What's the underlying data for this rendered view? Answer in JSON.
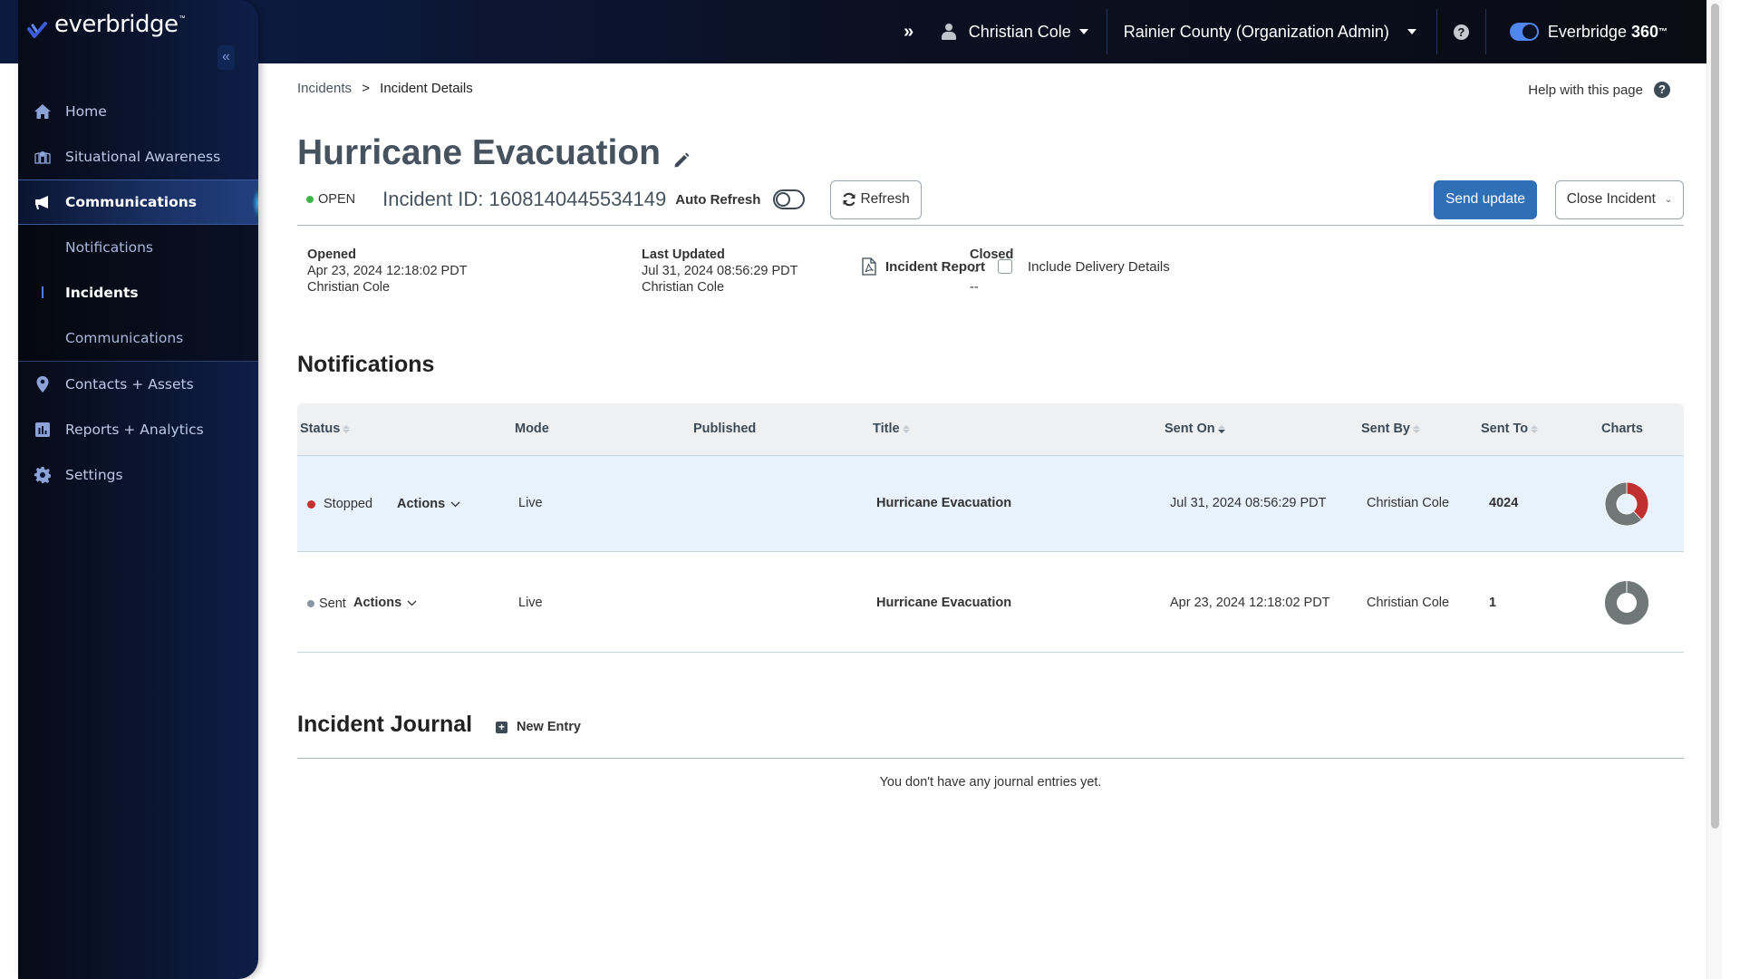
{
  "app": {
    "logo_text": "everbridge",
    "logo_tm": "™",
    "brand_color": "#4c7ef0"
  },
  "topbar": {
    "expand_icon": "double-chevron-right-icon",
    "user_name": "Christian Cole",
    "organization": "Rainier County (Organization Admin)",
    "help_symbol": "?",
    "product_name": "Everbridge",
    "product_suffix": "360",
    "product_tm": "™"
  },
  "sidebar": {
    "collapse_symbol": "«",
    "items": [
      {
        "label": "Home",
        "icon": "home-icon"
      },
      {
        "label": "Situational Awareness",
        "icon": "map-icon"
      },
      {
        "label": "Communications",
        "icon": "megaphone-icon",
        "active": true
      },
      {
        "label": "Contacts + Assets",
        "icon": "location-pin-icon"
      },
      {
        "label": "Reports + Analytics",
        "icon": "bar-chart-icon"
      },
      {
        "label": "Settings",
        "icon": "gear-icon"
      }
    ],
    "subitems": [
      {
        "label": "Notifications"
      },
      {
        "label": "Incidents",
        "current": true
      },
      {
        "label": "Communications"
      }
    ]
  },
  "breadcrumb": {
    "parent": "Incidents",
    "separator": ">",
    "current": "Incident Details"
  },
  "help": {
    "label": "Help with this page",
    "symbol": "?"
  },
  "incident": {
    "title": "Hurricane Evacuation",
    "status": "OPEN",
    "status_color": "#3cb64a",
    "id_label": "Incident ID: 1608140445534149",
    "auto_refresh_label": "Auto Refresh",
    "auto_refresh_on": false,
    "refresh_label": "Refresh",
    "send_update_label": "Send update",
    "close_incident_label": "Close Incident",
    "opened": {
      "label": "Opened",
      "date": "Apr 23, 2024 12:18:02 PDT",
      "by": "Christian Cole"
    },
    "last_updated": {
      "label": "Last Updated",
      "date": "Jul 31, 2024 08:56:29 PDT",
      "by": "Christian Cole"
    },
    "closed": {
      "label": "Closed",
      "date": "--",
      "by": "--"
    },
    "report_label": "Incident Report",
    "include_delivery_label": "Include Delivery Details",
    "include_delivery_checked": false
  },
  "notifications": {
    "title": "Notifications",
    "columns": [
      "Status",
      "Mode",
      "Published",
      "Title",
      "Sent On",
      "Sent By",
      "Sent To",
      "Charts"
    ],
    "rows": [
      {
        "status": "Stopped",
        "status_color": "#c8302f",
        "actions_label": "Actions",
        "mode": "Live",
        "published": "",
        "title": "Hurricane Evacuation",
        "sent_on": "Jul 31, 2024 08:56:29 PDT",
        "sent_by": "Christian Cole",
        "sent_to": "4024",
        "chart": {
          "segments": [
            {
              "name": "stopped",
              "fraction": 0.38,
              "color": "#c0302f"
            },
            {
              "name": "other",
              "fraction": 0.62,
              "color": "#6f7877"
            }
          ]
        }
      },
      {
        "status": "Sent",
        "status_color": "#8a96a3",
        "actions_label": "Actions",
        "mode": "Live",
        "published": "",
        "title": "Hurricane Evacuation",
        "sent_on": "Apr 23, 2024 12:18:02 PDT",
        "sent_by": "Christian Cole",
        "sent_to": "1",
        "chart": {
          "segments": [
            {
              "name": "other",
              "fraction": 1.0,
              "color": "#6f7877"
            }
          ]
        }
      }
    ]
  },
  "journal": {
    "title": "Incident Journal",
    "new_entry_label": "New Entry",
    "empty_message": "You don't have any journal entries yet."
  }
}
